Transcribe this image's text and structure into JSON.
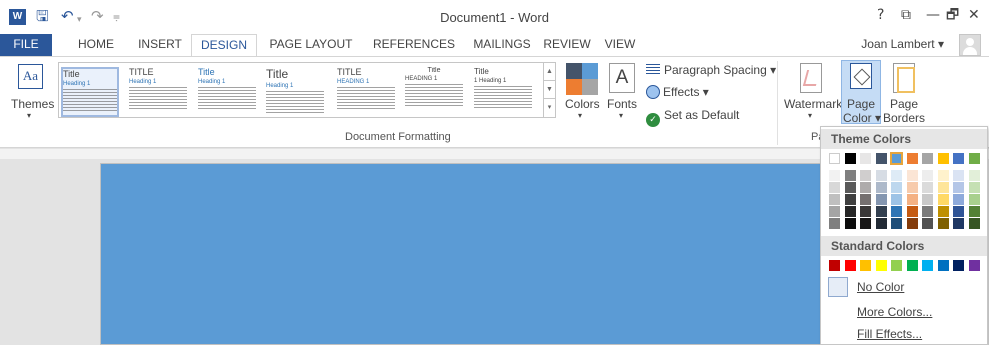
{
  "window": {
    "title": "Document1 - Word",
    "app_icon_letter": "W",
    "controls": [
      "?",
      "⧉",
      "—",
      "🗗",
      "✕"
    ]
  },
  "tabs": {
    "file": "FILE",
    "items": [
      "HOME",
      "INSERT",
      "DESIGN",
      "PAGE LAYOUT",
      "REFERENCES",
      "MAILINGS",
      "REVIEW",
      "VIEW"
    ],
    "active": "DESIGN",
    "user": "Joan Lambert ▾"
  },
  "ribbon": {
    "themes_label": "Themes",
    "themes_icon_text": "Aa",
    "style_set": {
      "titles": [
        "Title",
        "TITLE",
        "Title",
        "Title",
        "TITLE",
        "Title",
        "Title"
      ],
      "headings": [
        "Heading 1",
        "Heading 1",
        "Heading 1",
        "Heading 1",
        "HEADING 1",
        "HEADING 1",
        "1 Heading 1"
      ]
    },
    "colors_label": "Colors",
    "fonts_label": "Fonts",
    "fonts_icon_text": "A",
    "paragraph_spacing": "Paragraph Spacing ▾",
    "effects": "Effects ▾",
    "set_default": "Set as Default",
    "document_formatting": "Document Formatting",
    "watermark": "Watermark",
    "page_color_1": "Page",
    "page_color_2": "Color ▾",
    "page_borders_1": "Page",
    "page_borders_2": "Borders",
    "page_bg_group": "Pa"
  },
  "dropdown": {
    "theme_colors": "Theme Colors",
    "standard_colors": "Standard Colors",
    "no_color": "No Color",
    "more_colors": "More Colors...",
    "fill_effects": "Fill Effects...",
    "theme_top": [
      "#ffffff",
      "#000000",
      "#e7e6e6",
      "#44546a",
      "#5b9bd5",
      "#ed7d31",
      "#a5a5a5",
      "#ffc000",
      "#4472c4",
      "#70ad47"
    ],
    "theme_shades": [
      [
        "#f2f2f2",
        "#7f7f7f",
        "#d0cece",
        "#d6dce4",
        "#deebf6",
        "#fbe5d5",
        "#ededed",
        "#fff2cc",
        "#dae3f3",
        "#e2efd9"
      ],
      [
        "#d8d8d8",
        "#595959",
        "#aeabab",
        "#adb9ca",
        "#bdd7ee",
        "#f7cbac",
        "#dbdbdb",
        "#fee599",
        "#b4c6e7",
        "#c5e0b3"
      ],
      [
        "#bfbfbf",
        "#3f3f3f",
        "#757070",
        "#8496b0",
        "#9dc3e6",
        "#f4b183",
        "#c9c9c9",
        "#ffd965",
        "#8eaadb",
        "#a8d08d"
      ],
      [
        "#a5a5a5",
        "#262626",
        "#3a3838",
        "#323f4f",
        "#2e75b5",
        "#c55a11",
        "#7b7b7b",
        "#bf9000",
        "#2f5496",
        "#538135"
      ],
      [
        "#7f7f7f",
        "#0c0c0c",
        "#171616",
        "#222a35",
        "#1e4e79",
        "#843c0b",
        "#525252",
        "#7f6000",
        "#1f3864",
        "#375623"
      ]
    ],
    "standard": [
      "#c00000",
      "#ff0000",
      "#ffc000",
      "#ffff00",
      "#92d050",
      "#00b050",
      "#00b0f0",
      "#0070c0",
      "#002060",
      "#7030a0"
    ],
    "selected_index": 4
  },
  "colors": {
    "accent": "#2b579a",
    "page_color": "#5b9bd5",
    "colors_icon": [
      "#44546a",
      "#5b9bd5",
      "#ed7d31",
      "#a5a5a5"
    ]
  }
}
